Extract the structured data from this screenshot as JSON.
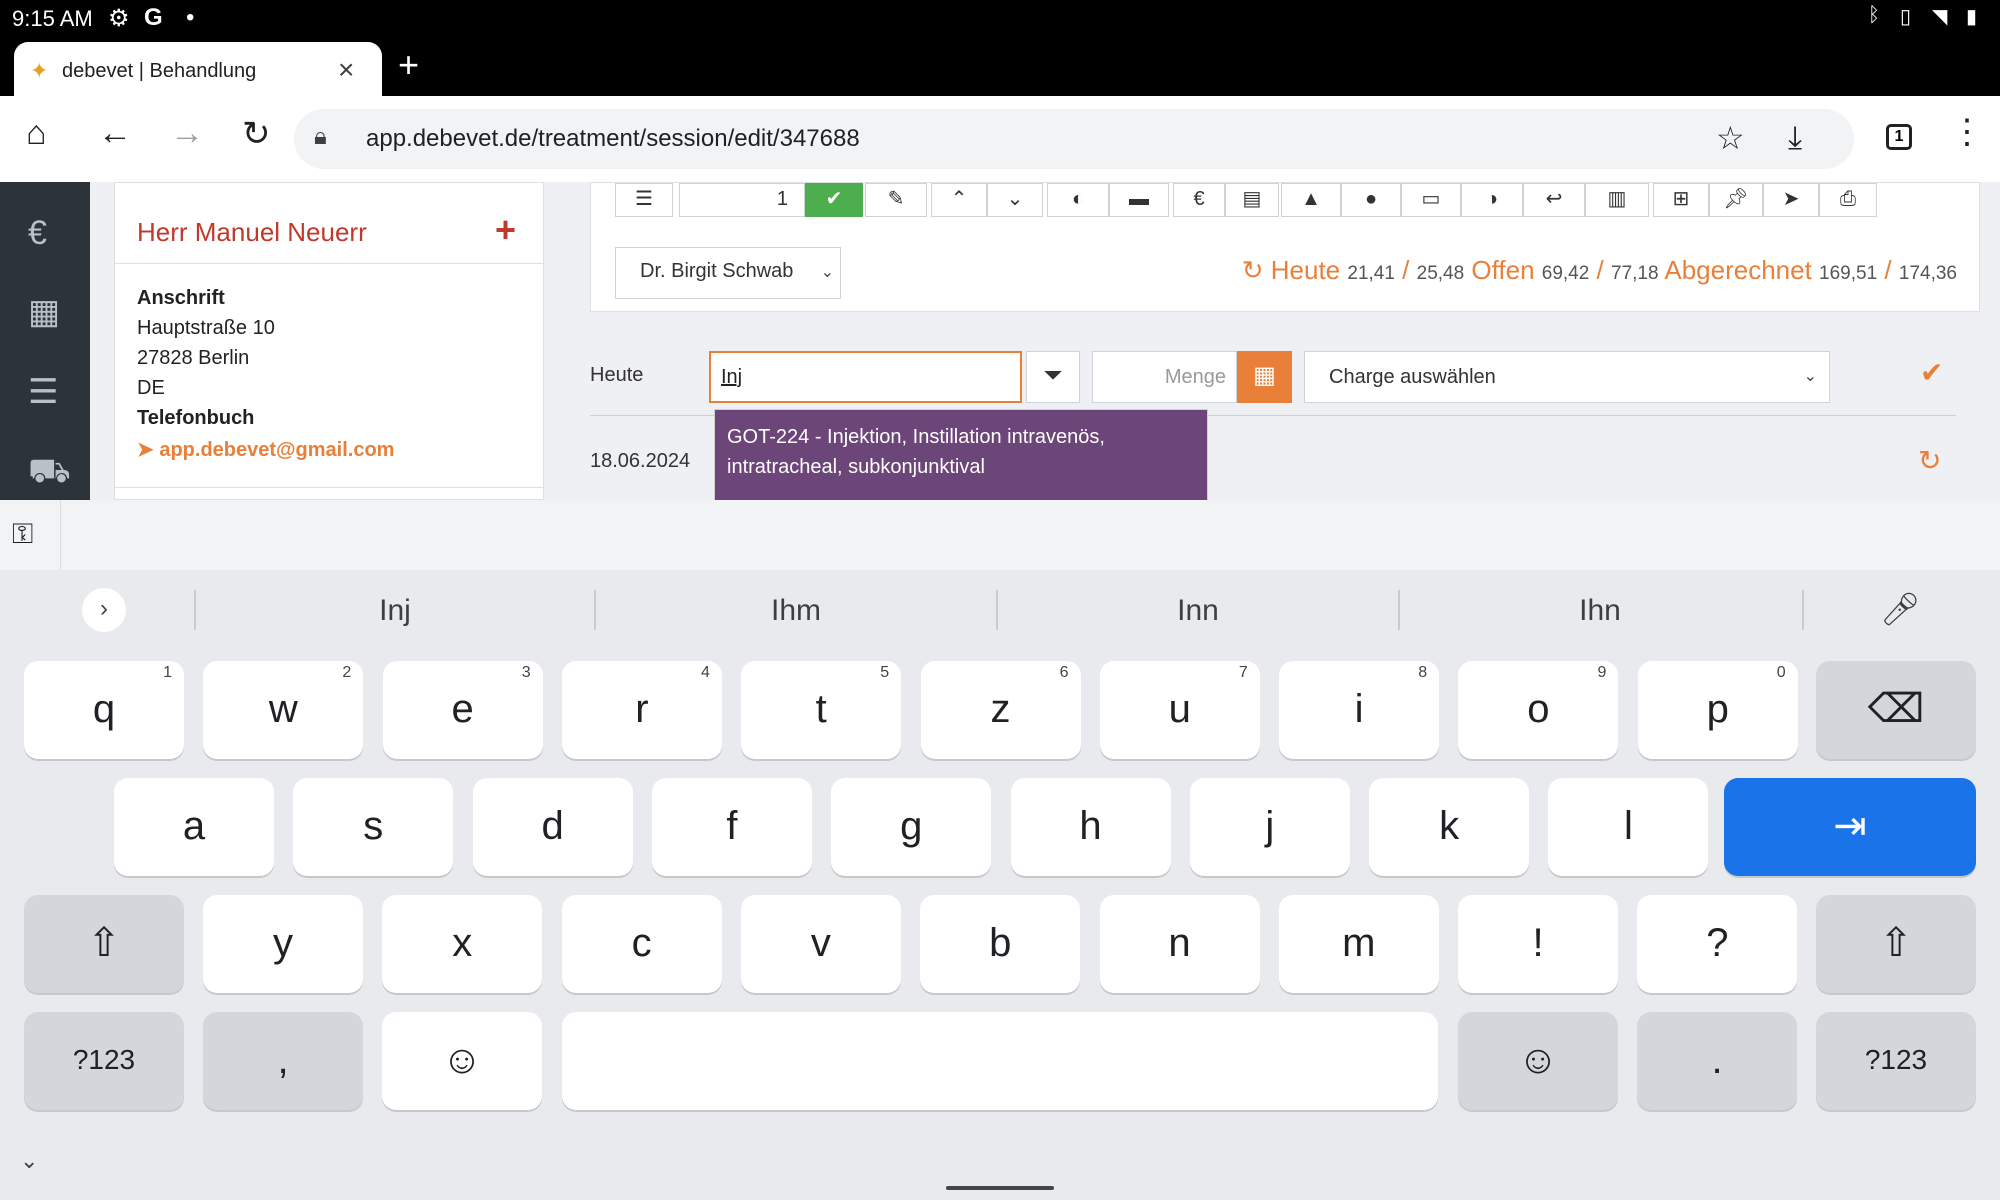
{
  "status": {
    "time": "9:15 AM"
  },
  "browser": {
    "tab_title": "debevet | Behandlung",
    "url": "app.debevet.de/treatment/session/edit/347688",
    "tab_count": "1"
  },
  "patient": {
    "name": "Herr Manuel Neuerr",
    "address_label": "Anschrift",
    "street": "Hauptstraße 10",
    "city": "27828  Berlin",
    "country": "DE",
    "phonebook_label": "Telefonbuch",
    "email": "app.debevet@gmail.com"
  },
  "toolbar": {
    "quantity": "1"
  },
  "vet": {
    "selected": "Dr. Birgit Schwab"
  },
  "stats": {
    "heute_label": "Heute",
    "heute_values": "21,41",
    "heute_total": "25,48",
    "offen_label": "Offen",
    "offen_values": "69,42",
    "offen_total": "77,18",
    "abgerechnet_label": "Abgerechnet",
    "abgerechnet_values": "169,51",
    "abgerechnet_total": "174,36"
  },
  "entry": {
    "date_label": "Heute",
    "search_value": "Inj",
    "menge_placeholder": "Menge",
    "charge_placeholder": "Charge auswählen",
    "dropdown_item": "GOT-224 - Injektion, Instillation intravenös, intratracheal, subkonjunktival",
    "history_date": "18.06.2024"
  },
  "keyboard": {
    "suggestions": [
      "Inj",
      "Ihm",
      "Inn",
      "Ihn"
    ],
    "row1": [
      "q",
      "w",
      "e",
      "r",
      "t",
      "z",
      "u",
      "i",
      "o",
      "p"
    ],
    "row1_hints": [
      "1",
      "2",
      "3",
      "4",
      "5",
      "6",
      "7",
      "8",
      "9",
      "0"
    ],
    "row2": [
      "a",
      "s",
      "d",
      "f",
      "g",
      "h",
      "j",
      "k",
      "l"
    ],
    "row3": [
      "y",
      "x",
      "c",
      "v",
      "b",
      "n",
      "m",
      "!",
      "?"
    ],
    "symbols_label": "?123",
    "comma": ",",
    "period": "."
  }
}
